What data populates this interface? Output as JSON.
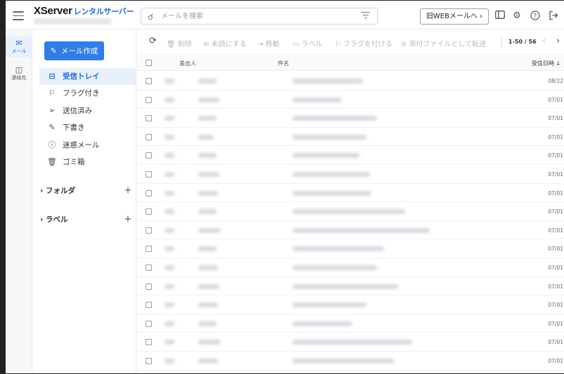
{
  "app": {
    "brand": "XServer",
    "brand_sub": "レンタルサーバー"
  },
  "header": {
    "search_placeholder": "メールを検索",
    "old_web_mail": "旧WEBメールへ ›",
    "icons": [
      "menu-icon",
      "search-icon",
      "filter-icon",
      "panel-icon",
      "gear-icon",
      "help-icon",
      "logout-icon"
    ]
  },
  "rail": {
    "items": [
      {
        "label": "メール",
        "icon": "mail-icon",
        "active": true
      },
      {
        "label": "連絡先",
        "icon": "contacts-icon",
        "active": false
      }
    ]
  },
  "sidebar": {
    "compose_label": "メール作成",
    "folders": [
      {
        "label": "受信トレイ",
        "icon": "inbox-icon",
        "active": true
      },
      {
        "label": "フラグ付き",
        "icon": "flag-icon",
        "active": false
      },
      {
        "label": "送信済み",
        "icon": "send-icon",
        "active": false
      },
      {
        "label": "下書き",
        "icon": "draft-icon",
        "active": false
      },
      {
        "label": "迷惑メール",
        "icon": "spam-icon",
        "active": false
      },
      {
        "label": "ゴミ箱",
        "icon": "trash-icon",
        "active": false
      }
    ],
    "sections": [
      {
        "label": "フォルダ"
      },
      {
        "label": "ラベル"
      }
    ]
  },
  "toolbar": {
    "actions": [
      {
        "label": "削除",
        "icon": "trash-icon"
      },
      {
        "label": "未読にする",
        "icon": "mail-icon"
      },
      {
        "label": "移動",
        "icon": "move-icon"
      },
      {
        "label": "ラベル",
        "icon": "label-icon"
      },
      {
        "label": "フラグを付ける",
        "icon": "flag-icon"
      },
      {
        "label": "添付ファイルとして転送",
        "icon": "attach-icon"
      }
    ],
    "pagination": "1-50 / 56"
  },
  "table": {
    "col_from": "差出人",
    "col_subject": "件名",
    "col_date": "受信日時 ↓",
    "dates": [
      "08/22",
      "07/01",
      "07/01",
      "07/01",
      "07/01",
      "07/01",
      "07/01",
      "07/01",
      "07/01",
      "07/01",
      "07/01",
      "07/01",
      "07/01",
      "07/01",
      "07/01",
      "07/01"
    ]
  }
}
